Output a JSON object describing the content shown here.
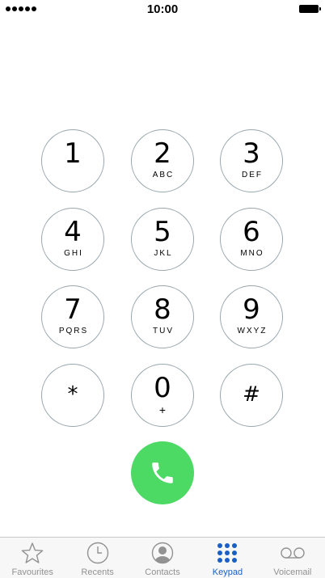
{
  "status_bar": {
    "time": "10:00"
  },
  "keypad": [
    {
      "digit": "1",
      "letters": ""
    },
    {
      "digit": "2",
      "letters": "ABC"
    },
    {
      "digit": "3",
      "letters": "DEF"
    },
    {
      "digit": "4",
      "letters": "GHI"
    },
    {
      "digit": "5",
      "letters": "JKL"
    },
    {
      "digit": "6",
      "letters": "MNO"
    },
    {
      "digit": "7",
      "letters": "PQRS"
    },
    {
      "digit": "8",
      "letters": "TUV"
    },
    {
      "digit": "9",
      "letters": "WXYZ"
    },
    {
      "digit": "*",
      "letters": ""
    },
    {
      "digit": "0",
      "letters": "+"
    },
    {
      "digit": "#",
      "letters": ""
    }
  ],
  "call_button": {
    "icon": "phone-icon",
    "color": "#4cd964"
  },
  "tab_bar": {
    "active": "Keypad",
    "active_color": "#1a5fc2",
    "inactive_color": "#929292",
    "tabs": [
      {
        "label": "Favourites",
        "icon": "star-icon"
      },
      {
        "label": "Recents",
        "icon": "clock-icon"
      },
      {
        "label": "Contacts",
        "icon": "contact-icon"
      },
      {
        "label": "Keypad",
        "icon": "keypad-icon"
      },
      {
        "label": "Voicemail",
        "icon": "voicemail-icon"
      }
    ]
  }
}
